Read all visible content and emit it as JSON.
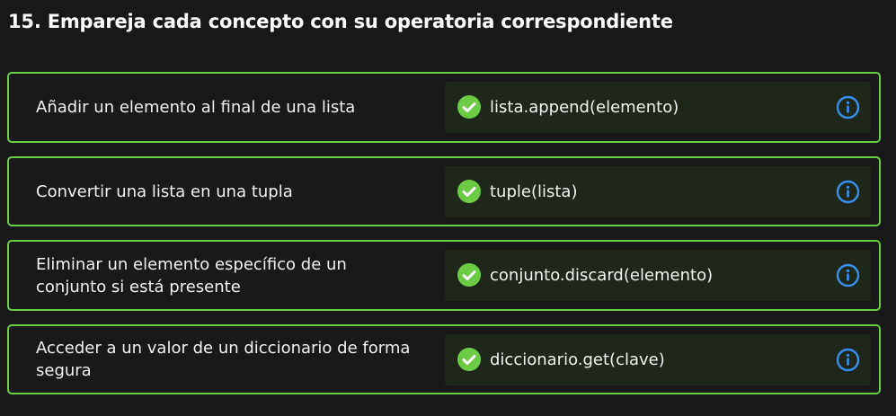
{
  "question": {
    "title": "15. Empareja cada concepto con su operatoria correspondiente"
  },
  "pairs": [
    {
      "concept": "Añadir un elemento al final de una lista",
      "answer": "lista.append(elemento)",
      "status": "correct"
    },
    {
      "concept": "Convertir una lista en una tupla",
      "answer": "tuple(lista)",
      "status": "correct"
    },
    {
      "concept": "Eliminar un elemento específico de un conjunto si está presente",
      "answer": "conjunto.discard(elemento)",
      "status": "correct"
    },
    {
      "concept": "Acceder a un valor de un diccionario de forma segura",
      "answer": "diccionario.get(clave)",
      "status": "correct"
    }
  ],
  "icons": {
    "status": "check-circle-icon",
    "info": "info-icon"
  },
  "colors": {
    "correct_border": "#6ccb45",
    "correct_check": "#6ccb45",
    "info_accent": "#3b8eea",
    "answer_bg": "#1e2719",
    "page_bg": "#181818"
  }
}
